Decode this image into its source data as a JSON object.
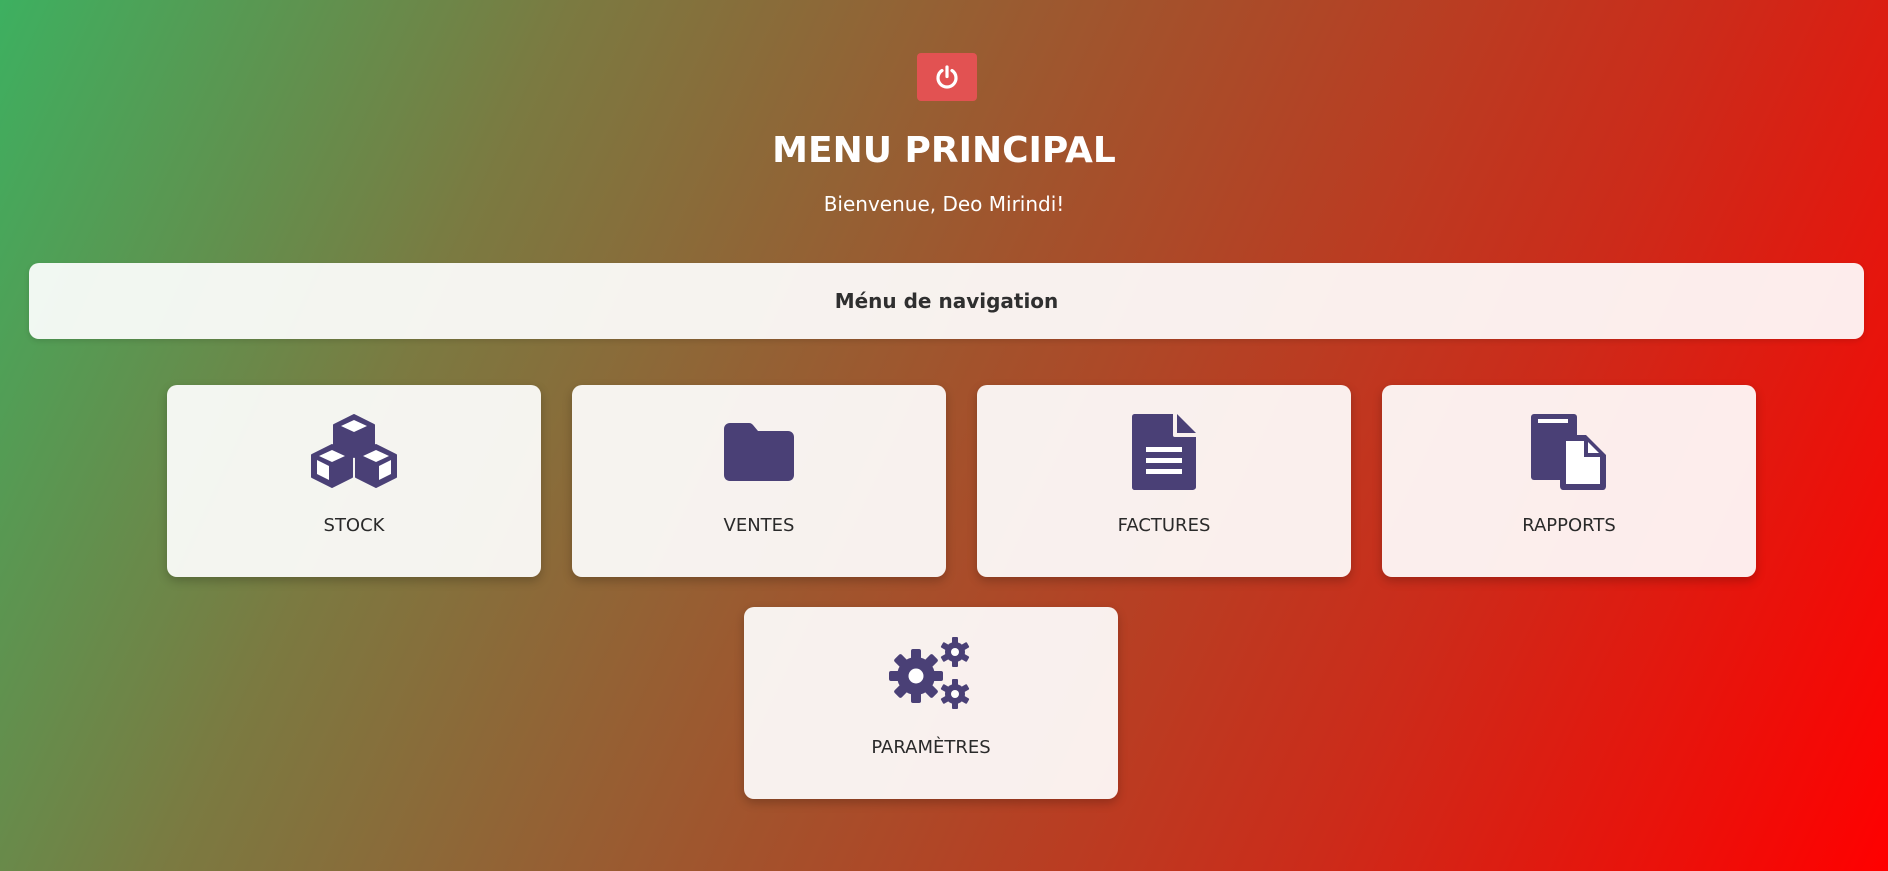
{
  "header": {
    "title": "MENU PRINCIPAL",
    "welcome": "Bienvenue, Deo Mirindi!",
    "logout_icon": "power-icon"
  },
  "nav": {
    "label": "Ménu de navigation"
  },
  "cards": [
    {
      "label": "STOCK",
      "icon": "cubes-icon"
    },
    {
      "label": "VENTES",
      "icon": "folder-icon"
    },
    {
      "label": "FACTURES",
      "icon": "file-lines-icon"
    },
    {
      "label": "RAPPORTS",
      "icon": "copy-icon"
    },
    {
      "label": "PARAMÈTRES",
      "icon": "gears-icon"
    }
  ],
  "colors": {
    "icon": "#4a4076",
    "logout_button": "#e25252",
    "gradient_start": "#3db060",
    "gradient_end": "#ff0000"
  }
}
